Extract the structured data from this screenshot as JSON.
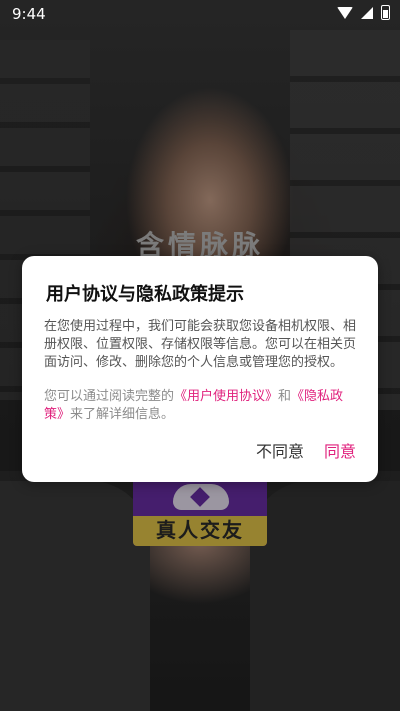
{
  "status_bar": {
    "time": "9:44",
    "icons": [
      "wifi-icon",
      "signal-icon",
      "battery-charging-icon"
    ]
  },
  "splash": {
    "app_name": "含情脉脉",
    "logo_text": "真人交友"
  },
  "dialog": {
    "title": "用户协议与隐私政策提示",
    "body": "在您使用过程中，我们可能会获取您设备相机权限、相册权限、位置权限、存储权限等信息。您可以在相关页面访问、修改、删除您的个人信息或管理您的授权。",
    "links_prefix": "您可以通过阅读完整的",
    "user_agreement": "《用户使用协议》",
    "links_and": "和",
    "privacy_policy": "《隐私政策》",
    "links_suffix": "来了解详细信息。",
    "disagree_label": "不同意",
    "agree_label": "同意"
  },
  "colors": {
    "accent": "#e0217d",
    "logo_purple": "#6a2fa8",
    "logo_yellow": "#e8c94a"
  }
}
